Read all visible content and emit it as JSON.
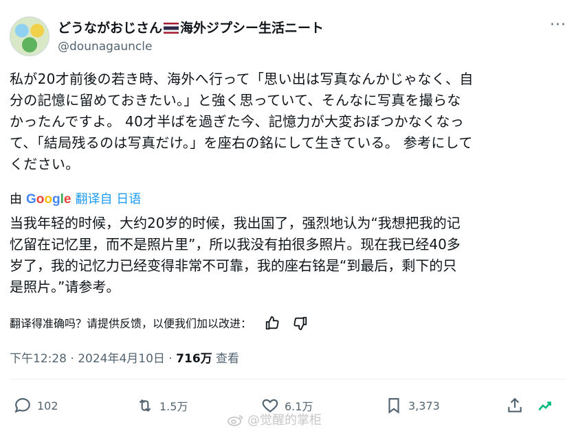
{
  "header": {
    "name_left": "どうながおじさん",
    "name_right": "海外ジプシー生活ニート",
    "handle": "@dounagauncle",
    "more_label": "···"
  },
  "tweet": {
    "text_lines": [
      "私が20才前後の若き時、海外へ行って「思い出は写真なんかじゃなく、自",
      "分の記憶に留めておきたい。」と強く思っていて、そんなに写真を撮らな",
      "かったんですよ。 40才半ばを過ぎた今、記憶力が大変おぼつかなくなっ",
      "て、「結局残るのは写真だけ。」を座右の銘にして生きている。 参考にして",
      "ください。"
    ]
  },
  "translation": {
    "by_label": "由",
    "google_g": "G",
    "google_o1": "o",
    "google_o2": "o",
    "google_g2": "g",
    "google_l": "l",
    "google_e": "e",
    "from_label": "翻译自 日语",
    "text_lines": [
      "当我年轻的时候，大约20岁的时候，我出国了，强烈地认为“我想把我的记",
      "忆留在记忆里，而不是照片里”，所以我没有拍很多照片。现在我已经40多",
      "岁了，我的记忆力已经变得非常不可靠，我的座右铭是“到最后，剩下的只",
      "是照片。”请参考。"
    ],
    "feedback_prompt": "翻译得准确吗？请提供反馈，以便我们加以改进："
  },
  "meta": {
    "time": "下午12:28",
    "sep1": " · ",
    "date": "2024年4月10日",
    "sep2": " · ",
    "views_count": "716万",
    "views_label": " 查看"
  },
  "actions": {
    "replies": "102",
    "retweets": "1.5万",
    "likes": "6.1万",
    "bookmarks": "3,373"
  },
  "watermark": {
    "text": "@觉醒的掌柜"
  },
  "colors": {
    "text": "#0f1419",
    "secondary": "#536471",
    "link": "#1d9bf0",
    "analytics": "#00ba7c"
  }
}
